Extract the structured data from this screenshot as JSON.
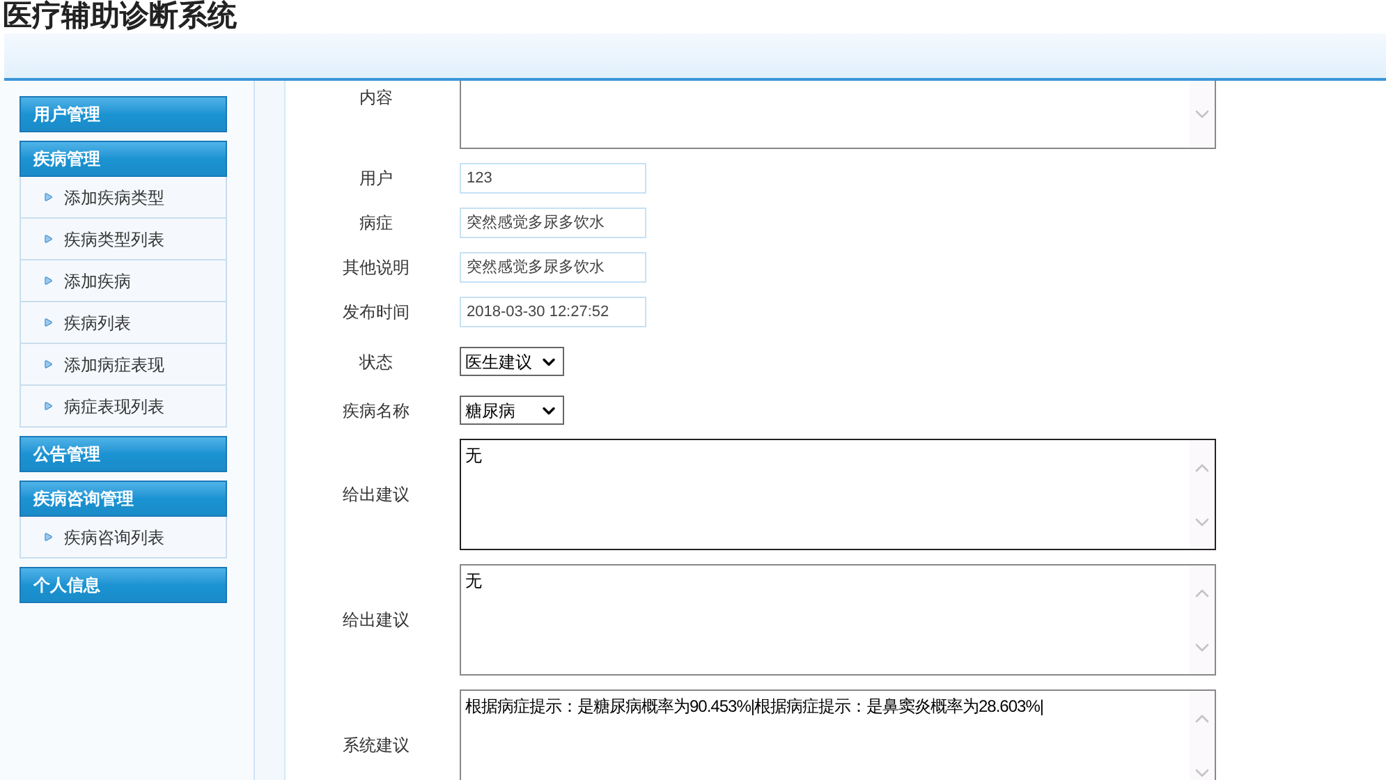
{
  "app_title": "医疗辅助诊断系统",
  "sidebar": {
    "groups": [
      {
        "label": "用户管理"
      },
      {
        "label": "疾病管理",
        "items": [
          {
            "label": "添加疾病类型"
          },
          {
            "label": "疾病类型列表"
          },
          {
            "label": "添加疾病"
          },
          {
            "label": "疾病列表"
          },
          {
            "label": "添加病症表现"
          },
          {
            "label": "病症表现列表"
          }
        ]
      },
      {
        "label": "公告管理"
      },
      {
        "label": "疾病咨询管理",
        "items": [
          {
            "label": "疾病咨询列表"
          }
        ]
      },
      {
        "label": "个人信息"
      }
    ]
  },
  "form": {
    "fields": [
      {
        "kind": "cut_textarea",
        "label": "内容",
        "focused": false
      },
      {
        "kind": "input",
        "label": "用户",
        "value": "123"
      },
      {
        "kind": "input",
        "label": "病症",
        "value": "突然感觉多尿多饮水"
      },
      {
        "kind": "input",
        "label": "其他说明",
        "value": "突然感觉多尿多饮水"
      },
      {
        "kind": "input",
        "label": "发布时间",
        "value": "2018-03-30 12:27:52"
      },
      {
        "kind": "select",
        "label": "状态",
        "value": "医生建议"
      },
      {
        "kind": "select",
        "label": "疾病名称",
        "value": "糖尿病"
      },
      {
        "kind": "textarea",
        "label": "给出建议",
        "value": "无",
        "focused": true
      },
      {
        "kind": "textarea",
        "label": "给出建议",
        "value": "无",
        "focused": false
      },
      {
        "kind": "textarea",
        "label": "系统建议",
        "value": "根据病症提示：是糖尿病概率为90.453%|根据病症提示：是鼻窦炎概率为28.603%|",
        "focused": false
      }
    ]
  }
}
